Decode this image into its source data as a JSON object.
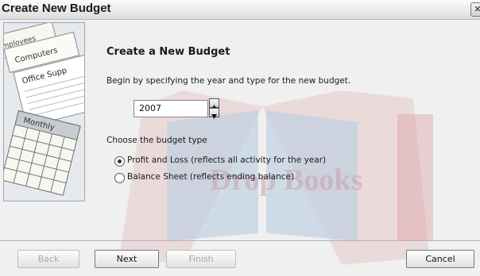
{
  "window": {
    "title": "Create New Budget",
    "close_glyph": "✕"
  },
  "watermark": {
    "text": "Drop Books"
  },
  "art": {
    "labels": [
      "Employees",
      "Computers",
      "Office Supp",
      "Monthly"
    ]
  },
  "content": {
    "heading": "Create a New Budget",
    "intro": "Begin by specifying the year and type for the new budget.",
    "year": "2007",
    "choose_label": "Choose the budget type",
    "options": [
      {
        "label": "Profit and Loss (reflects all activity for the year)",
        "selected": true
      },
      {
        "label": "Balance Sheet (reflects ending balance)",
        "selected": false
      }
    ]
  },
  "buttons": {
    "back": "Back",
    "next": "Next",
    "finish": "Finish",
    "cancel": "Cancel"
  },
  "icons": {
    "close": "close-icon",
    "spin_up": "arrow-up-icon",
    "spin_down": "arrow-down-icon"
  }
}
